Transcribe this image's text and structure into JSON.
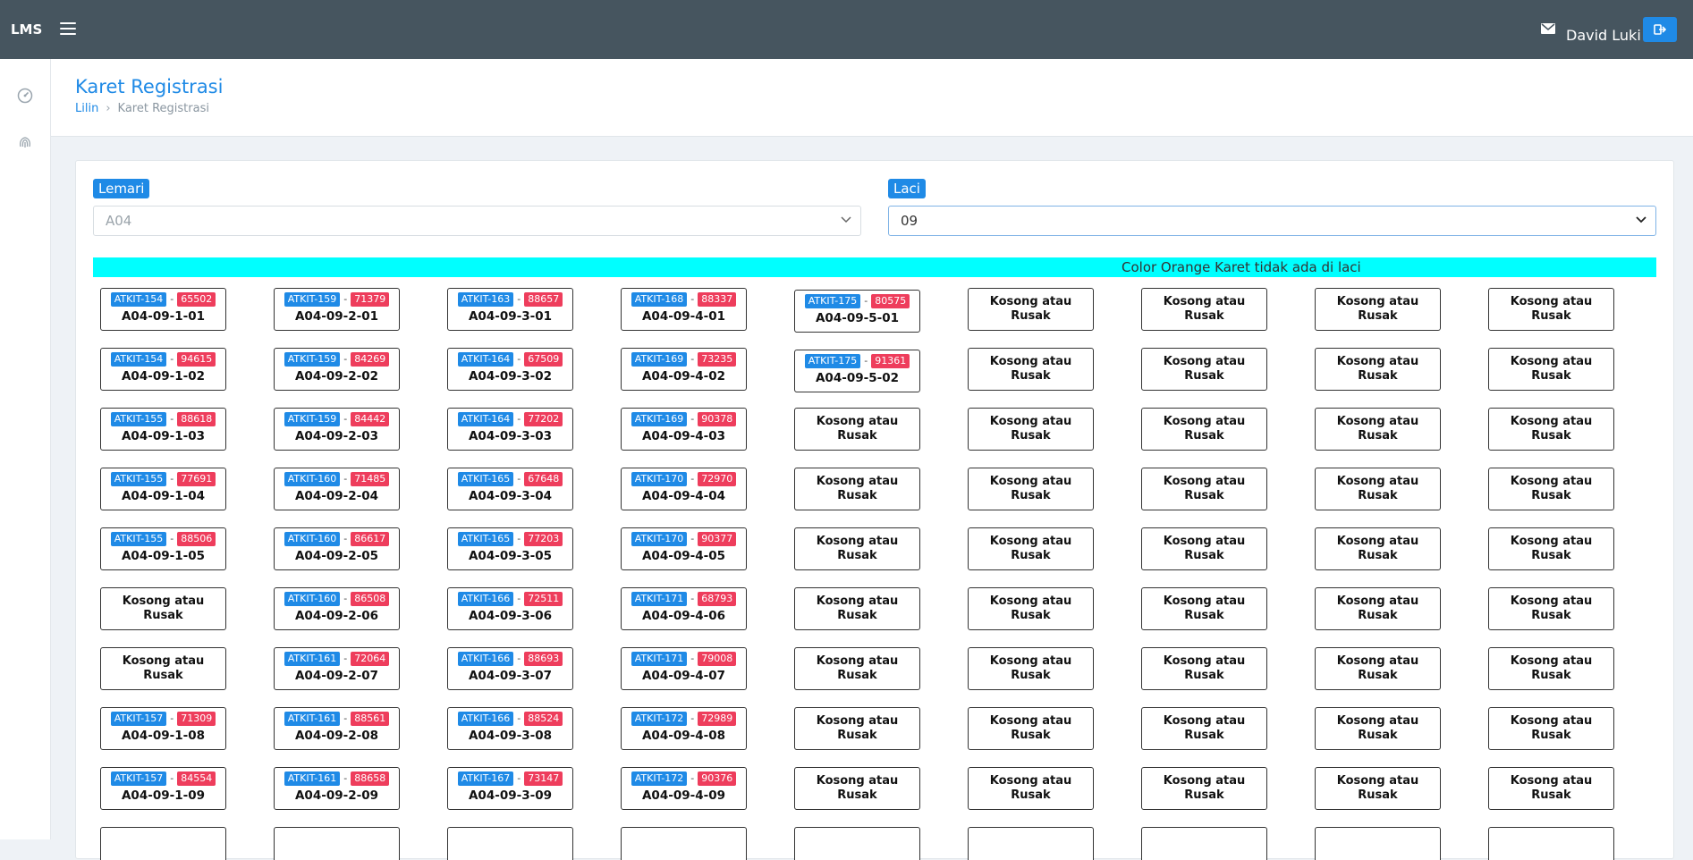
{
  "app": {
    "brand": "LMS",
    "user_name": "David Luki"
  },
  "page": {
    "title": "Karet Registrasi",
    "breadcrumb": [
      "Lilin",
      "Karet Registrasi"
    ]
  },
  "filters": {
    "lemari": {
      "label": "Lemari",
      "value": "A04"
    },
    "laci": {
      "label": "Laci",
      "value": "09"
    }
  },
  "banner": "Color Orange Karet tidak ada di laci",
  "icons": {
    "menu": "hamburger-icon",
    "mail": "mail-icon",
    "logout": "logout-icon",
    "sidebar": [
      "dashboard-icon",
      "fingerprint-icon"
    ]
  },
  "colors": {
    "topbar": "#46555f",
    "accent": "#1f8ae6",
    "badge_red": "#ee3d5c",
    "banner": "#00ffff"
  },
  "empty_label_line1": "Kosong atau",
  "empty_label_line2": "Rusak",
  "slots": [
    [
      {
        "id": "ATKIT-154",
        "num": "65502",
        "code": "A04-09-1-01"
      },
      {
        "id": "ATKIT-159",
        "num": "71379",
        "code": "A04-09-2-01"
      },
      {
        "id": "ATKIT-163",
        "num": "88657",
        "code": "A04-09-3-01"
      },
      {
        "id": "ATKIT-168",
        "num": "88337",
        "code": "A04-09-4-01"
      },
      {
        "id": "ATKIT-175",
        "num": "80575",
        "code": "A04-09-5-01"
      },
      null,
      null,
      null,
      null
    ],
    [
      {
        "id": "ATKIT-154",
        "num": "94615",
        "code": "A04-09-1-02"
      },
      {
        "id": "ATKIT-159",
        "num": "84269",
        "code": "A04-09-2-02"
      },
      {
        "id": "ATKIT-164",
        "num": "67509",
        "code": "A04-09-3-02"
      },
      {
        "id": "ATKIT-169",
        "num": "73235",
        "code": "A04-09-4-02"
      },
      {
        "id": "ATKIT-175",
        "num": "91361",
        "code": "A04-09-5-02"
      },
      null,
      null,
      null,
      null
    ],
    [
      {
        "id": "ATKIT-155",
        "num": "88618",
        "code": "A04-09-1-03"
      },
      {
        "id": "ATKIT-159",
        "num": "84442",
        "code": "A04-09-2-03"
      },
      {
        "id": "ATKIT-164",
        "num": "77202",
        "code": "A04-09-3-03"
      },
      {
        "id": "ATKIT-169",
        "num": "90378",
        "code": "A04-09-4-03"
      },
      null,
      null,
      null,
      null,
      null
    ],
    [
      {
        "id": "ATKIT-155",
        "num": "77691",
        "code": "A04-09-1-04"
      },
      {
        "id": "ATKIT-160",
        "num": "71485",
        "code": "A04-09-2-04"
      },
      {
        "id": "ATKIT-165",
        "num": "67648",
        "code": "A04-09-3-04"
      },
      {
        "id": "ATKIT-170",
        "num": "72970",
        "code": "A04-09-4-04"
      },
      null,
      null,
      null,
      null,
      null
    ],
    [
      {
        "id": "ATKIT-155",
        "num": "88506",
        "code": "A04-09-1-05"
      },
      {
        "id": "ATKIT-160",
        "num": "86617",
        "code": "A04-09-2-05"
      },
      {
        "id": "ATKIT-165",
        "num": "77203",
        "code": "A04-09-3-05"
      },
      {
        "id": "ATKIT-170",
        "num": "90377",
        "code": "A04-09-4-05"
      },
      null,
      null,
      null,
      null,
      null
    ],
    [
      null,
      {
        "id": "ATKIT-160",
        "num": "86508",
        "code": "A04-09-2-06"
      },
      {
        "id": "ATKIT-166",
        "num": "72511",
        "code": "A04-09-3-06"
      },
      {
        "id": "ATKIT-171",
        "num": "68793",
        "code": "A04-09-4-06"
      },
      null,
      null,
      null,
      null,
      null
    ],
    [
      null,
      {
        "id": "ATKIT-161",
        "num": "72064",
        "code": "A04-09-2-07"
      },
      {
        "id": "ATKIT-166",
        "num": "88693",
        "code": "A04-09-3-07"
      },
      {
        "id": "ATKIT-171",
        "num": "79008",
        "code": "A04-09-4-07"
      },
      null,
      null,
      null,
      null,
      null
    ],
    [
      {
        "id": "ATKIT-157",
        "num": "71309",
        "code": "A04-09-1-08"
      },
      {
        "id": "ATKIT-161",
        "num": "88561",
        "code": "A04-09-2-08"
      },
      {
        "id": "ATKIT-166",
        "num": "88524",
        "code": "A04-09-3-08"
      },
      {
        "id": "ATKIT-172",
        "num": "72989",
        "code": "A04-09-4-08"
      },
      null,
      null,
      null,
      null,
      null
    ],
    [
      {
        "id": "ATKIT-157",
        "num": "84554",
        "code": "A04-09-1-09"
      },
      {
        "id": "ATKIT-161",
        "num": "88658",
        "code": "A04-09-2-09"
      },
      {
        "id": "ATKIT-167",
        "num": "73147",
        "code": "A04-09-3-09"
      },
      {
        "id": "ATKIT-172",
        "num": "90376",
        "code": "A04-09-4-09"
      },
      null,
      null,
      null,
      null,
      null
    ]
  ]
}
